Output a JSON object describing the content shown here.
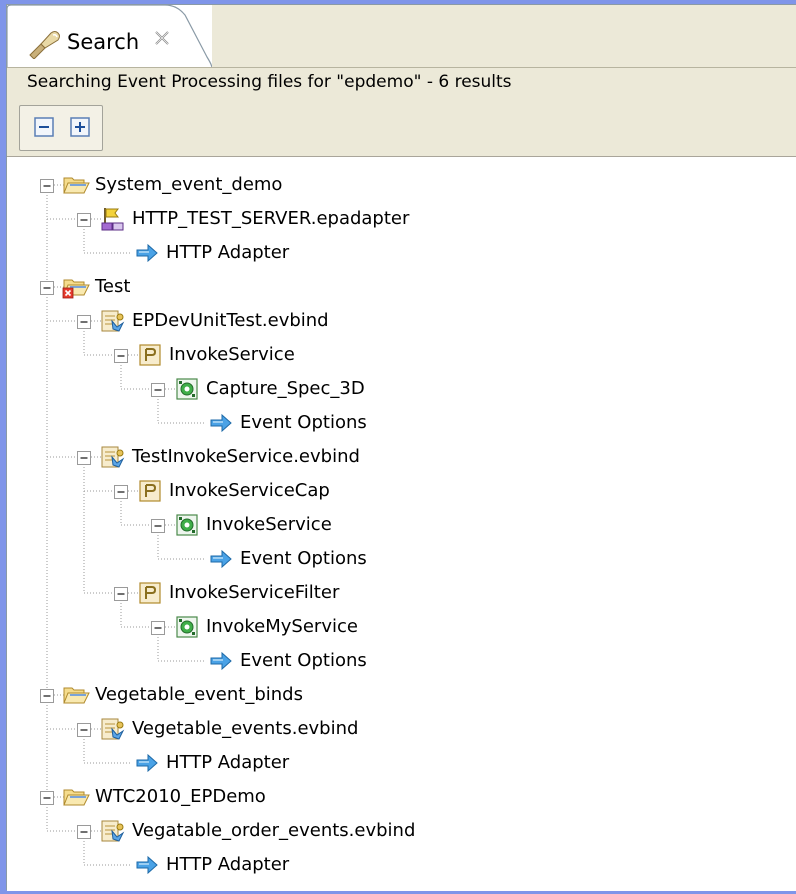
{
  "tab": {
    "title": "Search",
    "icon": "search-flashlight-icon",
    "close_icon": "close-icon"
  },
  "status": {
    "text": "Searching Event Processing files for \"epdemo\"  - 6 results"
  },
  "toolbar": {
    "collapse_all_icon": "collapse-all-icon",
    "expand_all_icon": "expand-all-icon"
  },
  "colors": {
    "accent_border": "#7f95e9",
    "chrome": "#ece9d8",
    "folder": "#e8c970",
    "arrow": "#3a8fd6"
  },
  "tree": [
    {
      "label": "System_event_demo",
      "icon": "folder-open-icon",
      "level": 0
    },
    {
      "label": "HTTP_TEST_SERVER.epadapter",
      "icon": "adapter-icon",
      "level": 1
    },
    {
      "label": "HTTP Adapter",
      "icon": "arrow-right-icon",
      "level": 2
    },
    {
      "label": "Test",
      "icon": "folder-open-error-icon",
      "level": 0
    },
    {
      "label": "EPDevUnitTest.evbind",
      "icon": "evbind-file-icon",
      "level": 1
    },
    {
      "label": "InvokeService",
      "icon": "pattern-icon",
      "level": 2
    },
    {
      "label": "Capture_Spec_3D",
      "icon": "capture-spec-icon",
      "level": 3
    },
    {
      "label": "Event Options",
      "icon": "arrow-right-icon",
      "level": 4
    },
    {
      "label": "TestInvokeService.evbind",
      "icon": "evbind-file-icon",
      "level": 1
    },
    {
      "label": "InvokeServiceCap",
      "icon": "pattern-icon",
      "level": 2
    },
    {
      "label": "InvokeService",
      "icon": "capture-spec-icon",
      "level": 3
    },
    {
      "label": "Event Options",
      "icon": "arrow-right-icon",
      "level": 4
    },
    {
      "label": "InvokeServiceFilter",
      "icon": "pattern-icon",
      "level": 2
    },
    {
      "label": "InvokeMyService",
      "icon": "capture-spec-icon",
      "level": 3
    },
    {
      "label": "Event Options",
      "icon": "arrow-right-icon",
      "level": 4
    },
    {
      "label": "Vegetable_event_binds",
      "icon": "folder-open-icon",
      "level": 0
    },
    {
      "label": "Vegetable_events.evbind",
      "icon": "evbind-file-icon",
      "level": 1
    },
    {
      "label": "HTTP Adapter",
      "icon": "arrow-right-icon",
      "level": 2
    },
    {
      "label": "WTC2010_EPDemo",
      "icon": "folder-open-icon",
      "level": 0
    },
    {
      "label": "Vegatable_order_events.evbind",
      "icon": "evbind-file-icon",
      "level": 1
    },
    {
      "label": "HTTP Adapter",
      "icon": "arrow-right-icon",
      "level": 2
    }
  ]
}
